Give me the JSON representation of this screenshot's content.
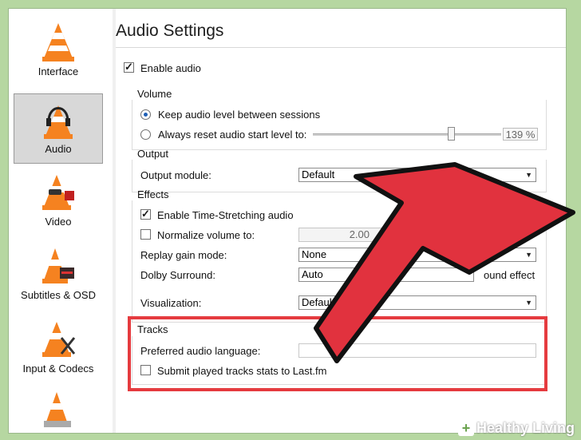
{
  "window": {
    "title": "Audio Settings"
  },
  "sidebar": {
    "items": [
      {
        "label": "Interface"
      },
      {
        "label": "Audio"
      },
      {
        "label": "Video"
      },
      {
        "label": "Subtitles & OSD"
      },
      {
        "label": "Input & Codecs"
      },
      {
        "label": ""
      }
    ]
  },
  "enable_audio": {
    "label": "Enable audio",
    "checked": true
  },
  "volume": {
    "section": "Volume",
    "keep_label": "Keep audio level between sessions",
    "reset_label": "Always reset audio start level to:",
    "level": "139 %"
  },
  "output": {
    "section": "Output",
    "module_label": "Output module:",
    "module_value": "Default"
  },
  "effects": {
    "section": "Effects",
    "timestretch_label": "Enable Time-Stretching audio",
    "normalize_label": "Normalize volume to:",
    "normalize_value": "2.00",
    "replay_label": "Replay gain mode:",
    "replay_value": "None",
    "dolby_label": "Dolby Surround:",
    "dolby_value": "Auto",
    "dolby_extra": "ound effect",
    "viz_label": "Visualization:",
    "viz_value": "Default"
  },
  "tracks": {
    "section": "Tracks",
    "lang_label": "Preferred audio language:",
    "lang_value": "",
    "lastfm_label": "Submit played tracks stats to Last.fm"
  },
  "watermark": {
    "text": "Healthy Living",
    "logo": "+"
  },
  "colors": {
    "highlight": "#e53b3f",
    "arrow": "#e1323e",
    "background": "#b6d7a1"
  }
}
